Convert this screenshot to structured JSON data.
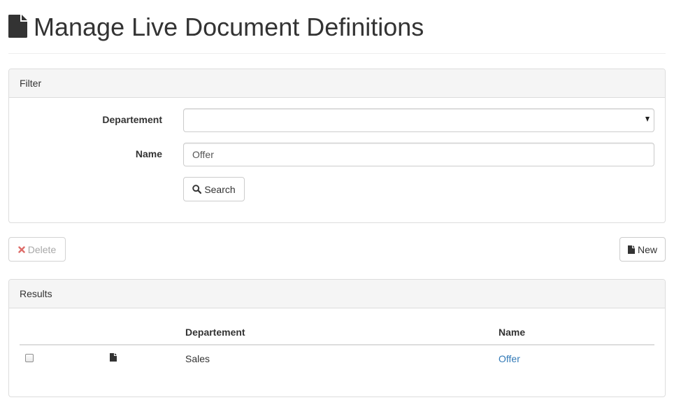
{
  "header": {
    "title": "Manage Live Document Definitions",
    "icon": "file-icon"
  },
  "filter": {
    "heading": "Filter",
    "departement_label": "Departement",
    "departement_value": "",
    "name_label": "Name",
    "name_value": "Offer",
    "search_label": "Search",
    "search_icon": "search-icon"
  },
  "actions": {
    "delete_label": "Delete",
    "delete_icon": "remove-icon",
    "delete_icon_color": "#d9534f",
    "new_label": "New",
    "new_icon": "file-icon"
  },
  "results": {
    "heading": "Results",
    "columns": [
      "",
      "",
      "Departement",
      "Name"
    ],
    "rows": [
      {
        "checked": false,
        "icon": "file-icon",
        "departement": "Sales",
        "name": "Offer"
      }
    ]
  },
  "colors": {
    "link": "#337ab7",
    "panel_heading_bg": "#f5f5f5",
    "border": "#dddddd"
  }
}
